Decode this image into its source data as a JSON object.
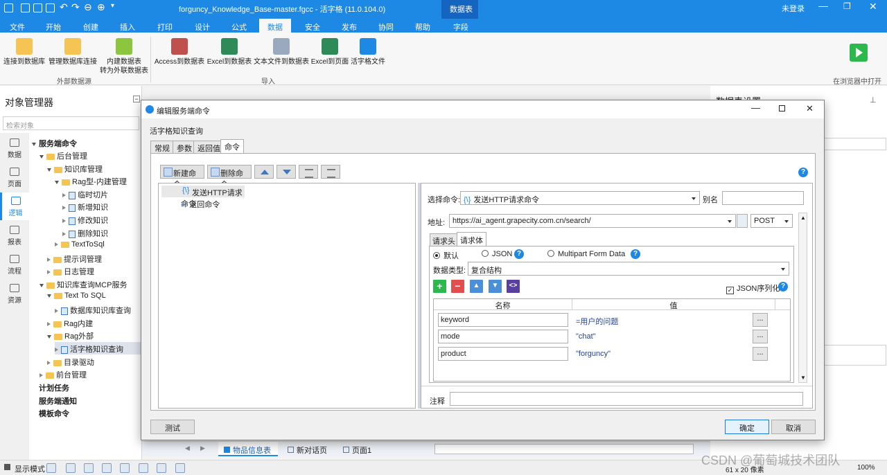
{
  "app": {
    "title": "forguncy_Knowledge_Base-master.fgcc - 活字格 (11.0.104.0)",
    "context_tab": "数据表",
    "login": "未登录"
  },
  "menu": [
    "文件",
    "开始",
    "创建",
    "插入",
    "打印",
    "设计",
    "公式",
    "数据",
    "安全",
    "发布",
    "协同",
    "帮助",
    "字段"
  ],
  "ribbon": {
    "external": [
      "连接到数据库",
      "管理数据库连接",
      "内建数据表",
      "转为外联数据表"
    ],
    "external_group": "外部数据源",
    "import": [
      "Access到数据表",
      "Excel到数据表",
      "文本文件到数据表",
      "Excel到页面",
      "活字格文件"
    ],
    "import_group": "导入",
    "run_label": "在浏览器中打开"
  },
  "object_manager": {
    "title": "对象管理器",
    "search_placeholder": "检索对象",
    "nav": [
      "数据",
      "页面",
      "逻辑",
      "报表",
      "流程",
      "资源"
    ],
    "tree": [
      "服务端命令",
      "后台管理",
      "知识库管理",
      "Rag型-内建管理",
      "临时切片",
      "新增知识",
      "修改知识",
      "删除知识",
      "TextToSql",
      "提示词管理",
      "日志管理",
      "知识库查询MCP服务",
      "Text To SQL",
      "数据库知识库查询",
      "Rag内建",
      "Rag外部",
      "活字格知识查询",
      "目录驱动",
      "前台管理",
      "计划任务",
      "服务端通知",
      "模板命令"
    ]
  },
  "right_panel": {
    "title": "数据表设置"
  },
  "bottom_tabs": [
    "物品信息表",
    "新对话页",
    "页面1"
  ],
  "status": {
    "mode": "显示模式",
    "size": "61 x 20 像素",
    "zoom": "100%"
  },
  "watermark": "CSDN @葡萄城技术团队",
  "dialog": {
    "title": "编辑服务端命令",
    "name": "活字格知识查询",
    "tabs": [
      "常规",
      "参数",
      "返回值",
      "命令"
    ],
    "toolbar": {
      "new": "新建命令",
      "delete": "删除命令"
    },
    "commands": [
      "发送HTTP请求命令",
      "返回命令"
    ],
    "editor": {
      "select_label": "选择命令:",
      "select_value": "发送HTTP请求命令",
      "alias_label": "别名",
      "url_label": "地址:",
      "url_value": "https://ai_agent.grapecity.com.cn/search/",
      "method": "POST",
      "subtabs": [
        "请求头",
        "请求体"
      ],
      "radio_default": "默认",
      "radio_json": "JSON",
      "radio_multipart": "Multipart Form Data",
      "datatype_label": "数据类型:",
      "datatype_value": "复合结构",
      "json_serialize": "JSON序列化",
      "col_name": "名称",
      "col_value": "值",
      "rows": [
        {
          "name": "keyword",
          "value": "=用户的问题"
        },
        {
          "name": "mode",
          "value": "\"chat\""
        },
        {
          "name": "product",
          "value": "\"forguncy\""
        }
      ],
      "ellipsis": "...",
      "note_label": "注释"
    },
    "buttons": {
      "test": "测试",
      "ok": "确定",
      "cancel": "取消"
    }
  }
}
